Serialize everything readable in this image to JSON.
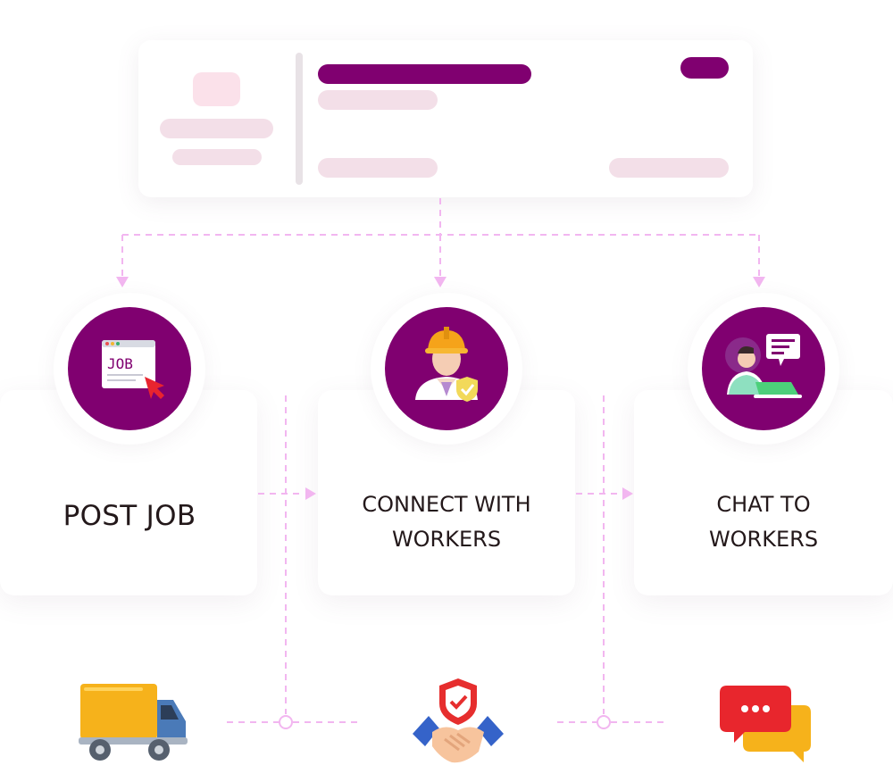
{
  "steps": [
    {
      "label_line1": "POST JOB",
      "label_line2": "",
      "icon": "job-post-icon"
    },
    {
      "label_line1": "CONNECT WITH",
      "label_line2": "WORKERS",
      "icon": "worker-helmet-icon"
    },
    {
      "label_line1": "CHAT TO",
      "label_line2": "WORKERS",
      "icon": "chat-worker-laptop-icon"
    }
  ],
  "job_icon_text": "JOB",
  "bottom_icons": [
    "delivery-truck-icon",
    "handshake-shield-icon",
    "chat-bubbles-icon"
  ],
  "colors": {
    "brand": "#800070",
    "pale_pink": "#f3dfe8",
    "connector": "#f2b6f0",
    "text": "#23181a"
  }
}
